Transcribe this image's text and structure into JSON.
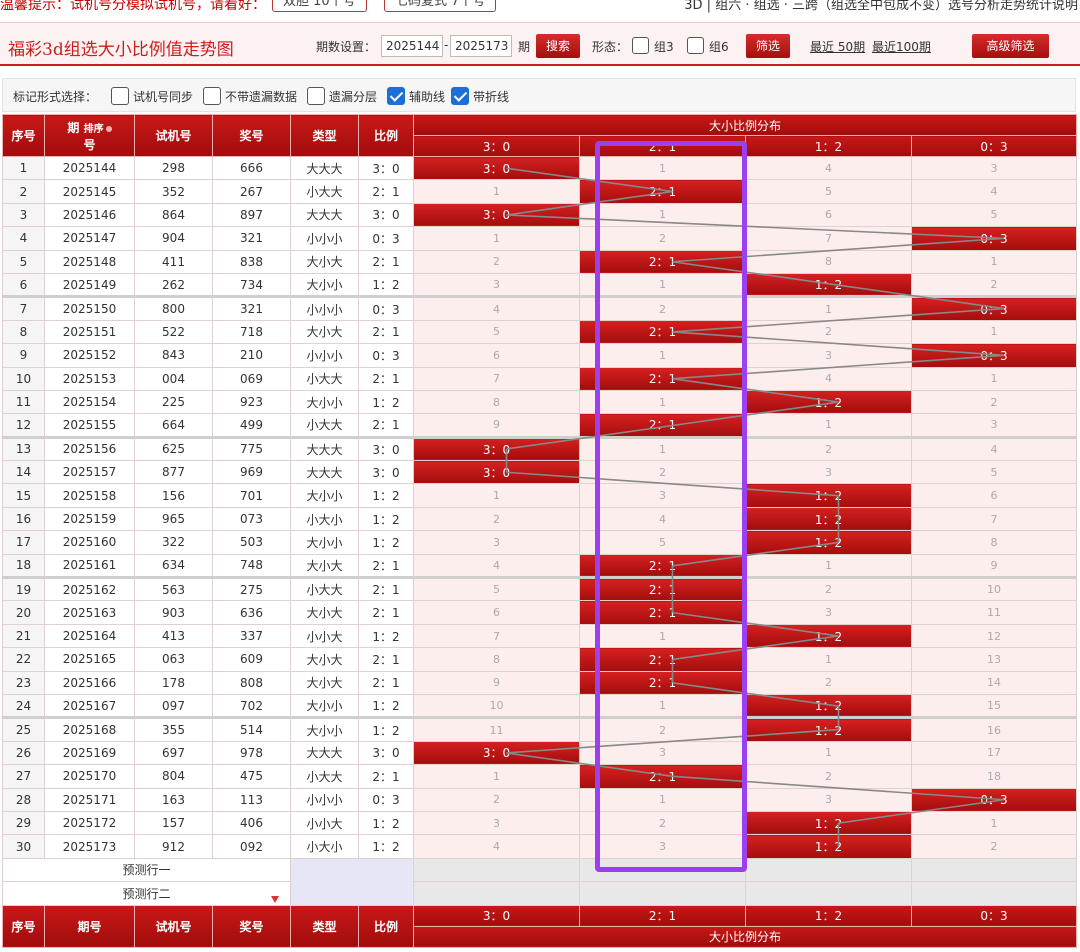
{
  "top": {
    "tip": "温馨提示：试机号分模拟试机号，请看好：",
    "btn1": "双胆 10个号",
    "btn2": "七码复式 7个号",
    "right": "3D | 组六 · 组选 · 三跨（组选全中包成不变）选号分析走势统计说明"
  },
  "header": {
    "title": "福彩3d组选大小比例值走势图",
    "period_label": "期数设置：",
    "from": "2025144",
    "dash": "-",
    "to": "2025173",
    "period_unit": "期",
    "search": "搜索",
    "form_label": "形态：",
    "g3": "组3",
    "g6": "组6",
    "filter": "筛选",
    "recent50": "最近 50期",
    "recent100": "最近100期",
    "advanced": "高级筛选"
  },
  "options": {
    "label": "标记形式选择：",
    "items": [
      {
        "label": "试机号同步",
        "checked": false
      },
      {
        "label": "不带遗漏数据",
        "checked": false
      },
      {
        "label": "遗漏分层",
        "checked": false
      },
      {
        "label": "辅助线",
        "checked": true
      },
      {
        "label": "带折线",
        "checked": true
      }
    ]
  },
  "table": {
    "headers": {
      "idx": "序号",
      "period_a": "期",
      "period_b": "号",
      "sort": "排序",
      "trial": "试机号",
      "prize": "奖号",
      "type": "类型",
      "ratio": "比例",
      "dist": "大小比例分布"
    },
    "ratio_cols": [
      "3：0",
      "2：1",
      "1：2",
      "0：3"
    ],
    "rows": [
      {
        "i": "1",
        "p": "2025144",
        "t": "298",
        "w": "666",
        "k": "大大大",
        "r": "3：0",
        "c": [
          "3：0",
          "1",
          "4",
          "3"
        ],
        "h": 0
      },
      {
        "i": "2",
        "p": "2025145",
        "t": "352",
        "w": "267",
        "k": "小大大",
        "r": "2：1",
        "c": [
          "1",
          "2：1",
          "5",
          "4"
        ],
        "h": 1
      },
      {
        "i": "3",
        "p": "2025146",
        "t": "864",
        "w": "897",
        "k": "大大大",
        "r": "3：0",
        "c": [
          "3：0",
          "1",
          "6",
          "5"
        ],
        "h": 0
      },
      {
        "i": "4",
        "p": "2025147",
        "t": "904",
        "w": "321",
        "k": "小小小",
        "r": "0：3",
        "c": [
          "1",
          "2",
          "7",
          "0：3"
        ],
        "h": 3
      },
      {
        "i": "5",
        "p": "2025148",
        "t": "411",
        "w": "838",
        "k": "大小大",
        "r": "2：1",
        "c": [
          "2",
          "2：1",
          "8",
          "1"
        ],
        "h": 1
      },
      {
        "i": "6",
        "p": "2025149",
        "t": "262",
        "w": "734",
        "k": "大小小",
        "r": "1：2",
        "c": [
          "3",
          "1",
          "1：2",
          "2"
        ],
        "h": 2
      },
      {
        "i": "7",
        "p": "2025150",
        "t": "800",
        "w": "321",
        "k": "小小小",
        "r": "0：3",
        "c": [
          "4",
          "2",
          "1",
          "0：3"
        ],
        "h": 3
      },
      {
        "i": "8",
        "p": "2025151",
        "t": "522",
        "w": "718",
        "k": "大小大",
        "r": "2：1",
        "c": [
          "5",
          "2：1",
          "2",
          "1"
        ],
        "h": 1
      },
      {
        "i": "9",
        "p": "2025152",
        "t": "843",
        "w": "210",
        "k": "小小小",
        "r": "0：3",
        "c": [
          "6",
          "1",
          "3",
          "0：3"
        ],
        "h": 3
      },
      {
        "i": "10",
        "p": "2025153",
        "t": "004",
        "w": "069",
        "k": "小大大",
        "r": "2：1",
        "c": [
          "7",
          "2：1",
          "4",
          "1"
        ],
        "h": 1
      },
      {
        "i": "11",
        "p": "2025154",
        "t": "225",
        "w": "923",
        "k": "大小小",
        "r": "1：2",
        "c": [
          "8",
          "1",
          "1：2",
          "2"
        ],
        "h": 2
      },
      {
        "i": "12",
        "p": "2025155",
        "t": "664",
        "w": "499",
        "k": "小大大",
        "r": "2：1",
        "c": [
          "9",
          "2：1",
          "1",
          "3"
        ],
        "h": 1
      },
      {
        "i": "13",
        "p": "2025156",
        "t": "625",
        "w": "775",
        "k": "大大大",
        "r": "3：0",
        "c": [
          "3：0",
          "1",
          "2",
          "4"
        ],
        "h": 0
      },
      {
        "i": "14",
        "p": "2025157",
        "t": "877",
        "w": "969",
        "k": "大大大",
        "r": "3：0",
        "c": [
          "3：0",
          "2",
          "3",
          "5"
        ],
        "h": 0
      },
      {
        "i": "15",
        "p": "2025158",
        "t": "156",
        "w": "701",
        "k": "大小小",
        "r": "1：2",
        "c": [
          "1",
          "3",
          "1：2",
          "6"
        ],
        "h": 2
      },
      {
        "i": "16",
        "p": "2025159",
        "t": "965",
        "w": "073",
        "k": "小大小",
        "r": "1：2",
        "c": [
          "2",
          "4",
          "1：2",
          "7"
        ],
        "h": 2
      },
      {
        "i": "17",
        "p": "2025160",
        "t": "322",
        "w": "503",
        "k": "大小小",
        "r": "1：2",
        "c": [
          "3",
          "5",
          "1：2",
          "8"
        ],
        "h": 2
      },
      {
        "i": "18",
        "p": "2025161",
        "t": "634",
        "w": "748",
        "k": "大小大",
        "r": "2：1",
        "c": [
          "4",
          "2：1",
          "1",
          "9"
        ],
        "h": 1
      },
      {
        "i": "19",
        "p": "2025162",
        "t": "563",
        "w": "275",
        "k": "小大大",
        "r": "2：1",
        "c": [
          "5",
          "2：1",
          "2",
          "10"
        ],
        "h": 1
      },
      {
        "i": "20",
        "p": "2025163",
        "t": "903",
        "w": "636",
        "k": "大小大",
        "r": "2：1",
        "c": [
          "6",
          "2：1",
          "3",
          "11"
        ],
        "h": 1
      },
      {
        "i": "21",
        "p": "2025164",
        "t": "413",
        "w": "337",
        "k": "小小大",
        "r": "1：2",
        "c": [
          "7",
          "1",
          "1：2",
          "12"
        ],
        "h": 2
      },
      {
        "i": "22",
        "p": "2025165",
        "t": "063",
        "w": "609",
        "k": "大小大",
        "r": "2：1",
        "c": [
          "8",
          "2：1",
          "1",
          "13"
        ],
        "h": 1
      },
      {
        "i": "23",
        "p": "2025166",
        "t": "178",
        "w": "808",
        "k": "大小大",
        "r": "2：1",
        "c": [
          "9",
          "2：1",
          "2",
          "14"
        ],
        "h": 1
      },
      {
        "i": "24",
        "p": "2025167",
        "t": "097",
        "w": "702",
        "k": "大小小",
        "r": "1：2",
        "c": [
          "10",
          "1",
          "1：2",
          "15"
        ],
        "h": 2
      },
      {
        "i": "25",
        "p": "2025168",
        "t": "355",
        "w": "514",
        "k": "大小小",
        "r": "1：2",
        "c": [
          "11",
          "2",
          "1：2",
          "16"
        ],
        "h": 2
      },
      {
        "i": "26",
        "p": "2025169",
        "t": "697",
        "w": "978",
        "k": "大大大",
        "r": "3：0",
        "c": [
          "3：0",
          "3",
          "1",
          "17"
        ],
        "h": 0
      },
      {
        "i": "27",
        "p": "2025170",
        "t": "804",
        "w": "475",
        "k": "小大大",
        "r": "2：1",
        "c": [
          "1",
          "2：1",
          "2",
          "18"
        ],
        "h": 1
      },
      {
        "i": "28",
        "p": "2025171",
        "t": "163",
        "w": "113",
        "k": "小小小",
        "r": "0：3",
        "c": [
          "2",
          "1",
          "3",
          "0：3"
        ],
        "h": 3
      },
      {
        "i": "29",
        "p": "2025172",
        "t": "157",
        "w": "406",
        "k": "小小大",
        "r": "1：2",
        "c": [
          "3",
          "2",
          "1：2",
          "1"
        ],
        "h": 2
      },
      {
        "i": "30",
        "p": "2025173",
        "t": "912",
        "w": "092",
        "k": "小大小",
        "r": "1：2",
        "c": [
          "4",
          "3",
          "1：2",
          "2"
        ],
        "h": 2
      }
    ],
    "pred1": "预测行一",
    "pred2": "预测行二"
  },
  "colors": {
    "hit": "#c41616",
    "line": "#888888",
    "highlight": "#9b40ef"
  }
}
